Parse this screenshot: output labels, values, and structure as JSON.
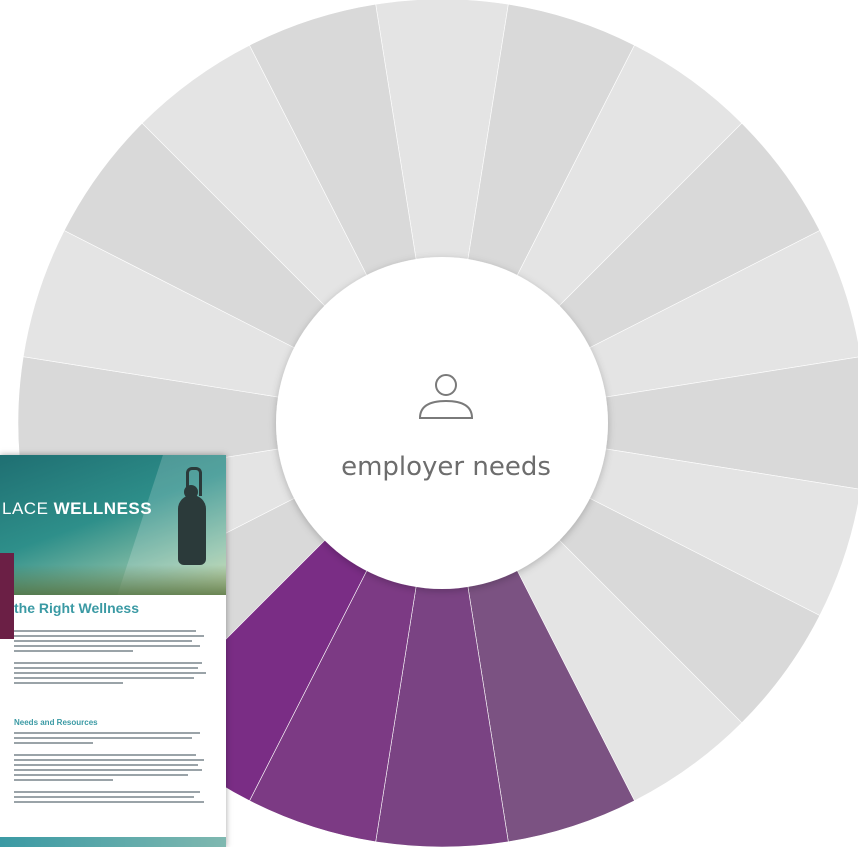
{
  "hub": {
    "label": "employer needs",
    "icon": "person-outline-icon"
  },
  "wheel": {
    "segment_count": 20,
    "colors": {
      "gray_light": "#e4e4e4",
      "gray_dark": "#d9d9d9",
      "purple_1": "#7a2d85",
      "purple_2": "#7c3a84",
      "purple_3": "#7a4383",
      "purple_4": "#7b5282",
      "hub_fill": "#ffffff",
      "hub_text": "#6d6d6d"
    }
  },
  "document": {
    "brand_prefix": "LACE ",
    "brand_bold": "WELLNESS",
    "title": "the Right Wellness",
    "section_heading": "Needs and Resources"
  }
}
